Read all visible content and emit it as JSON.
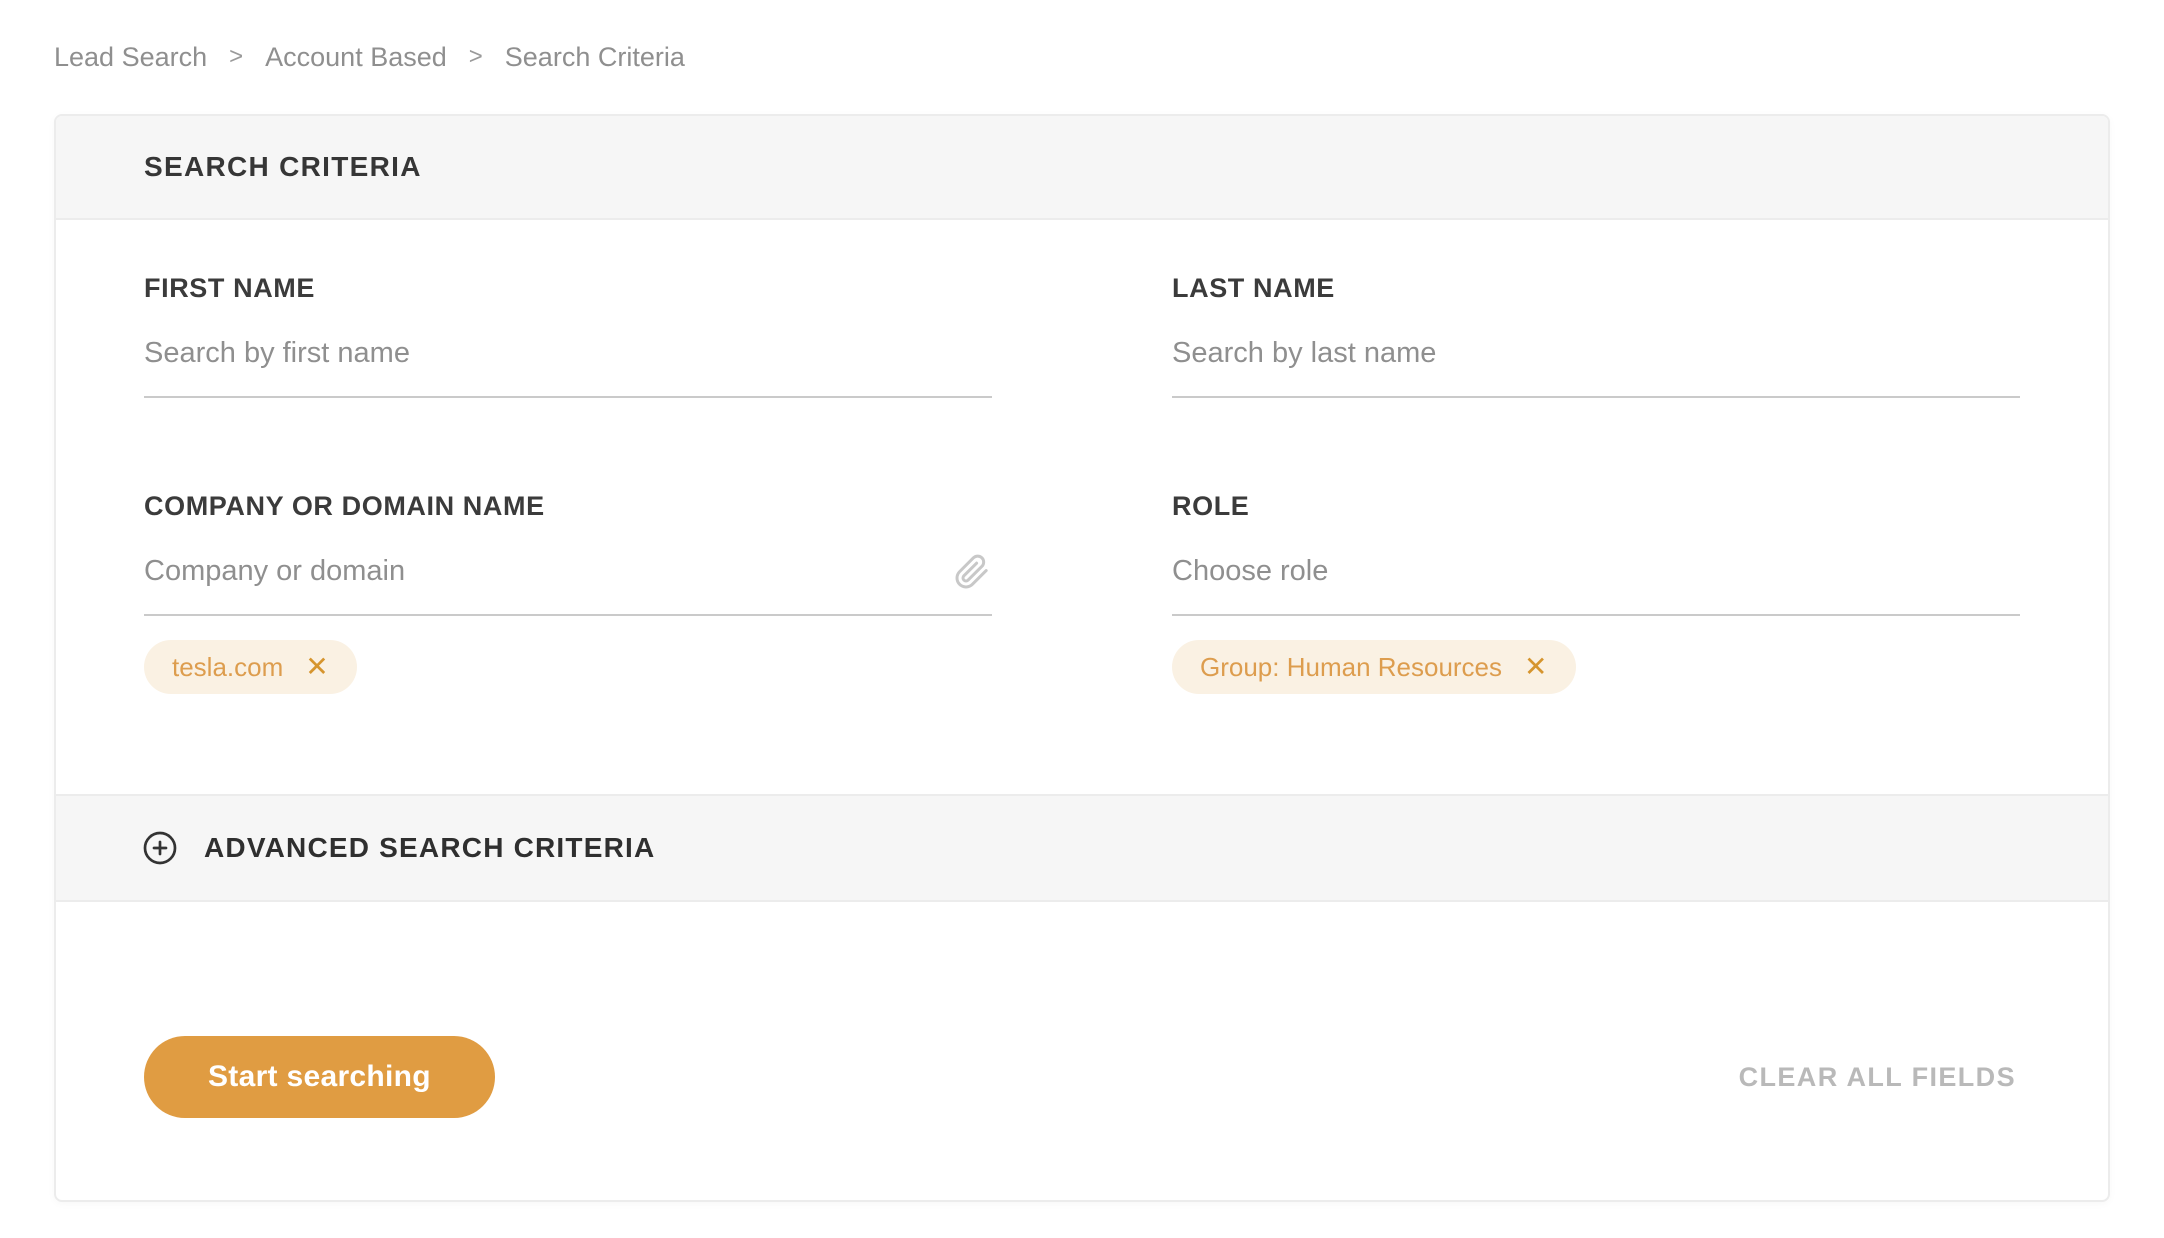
{
  "breadcrumb": {
    "separator": ">",
    "items": [
      {
        "label": "Lead Search"
      },
      {
        "label": "Account Based"
      },
      {
        "label": "Search Criteria"
      }
    ]
  },
  "panel": {
    "title": "SEARCH CRITERIA",
    "first_name": {
      "label": "FIRST NAME",
      "placeholder": "Search by first name",
      "value": ""
    },
    "last_name": {
      "label": "LAST NAME",
      "placeholder": "Search by last name",
      "value": ""
    },
    "company": {
      "label": "COMPANY OR DOMAIN NAME",
      "placeholder": "Company or domain",
      "value": "",
      "chips": [
        {
          "label": "tesla.com"
        }
      ]
    },
    "role": {
      "label": "ROLE",
      "placeholder": "Choose role",
      "value": "",
      "chips": [
        {
          "label": "Group: Human Resources"
        }
      ]
    },
    "advanced": {
      "label": "ADVANCED SEARCH CRITERIA"
    },
    "footer": {
      "start_button_label": "Start searching",
      "clear_button_label": "CLEAR ALL FIELDS"
    }
  },
  "icons": {
    "close_glyph": "✕",
    "paperclip": "paperclip-icon",
    "plus_circle": "plus-circle-icon"
  },
  "colors": {
    "accent": "#e09c42",
    "chip_bg": "#faf1e3",
    "chip_text": "#dd9d4e",
    "chip_close": "#d6952e",
    "band_bg": "#f6f6f6",
    "underline": "#cacaca",
    "label": "#3b3b3b",
    "muted": "#8f8f8f",
    "clear": "#b9b9b9",
    "card_border": "#ececec"
  }
}
